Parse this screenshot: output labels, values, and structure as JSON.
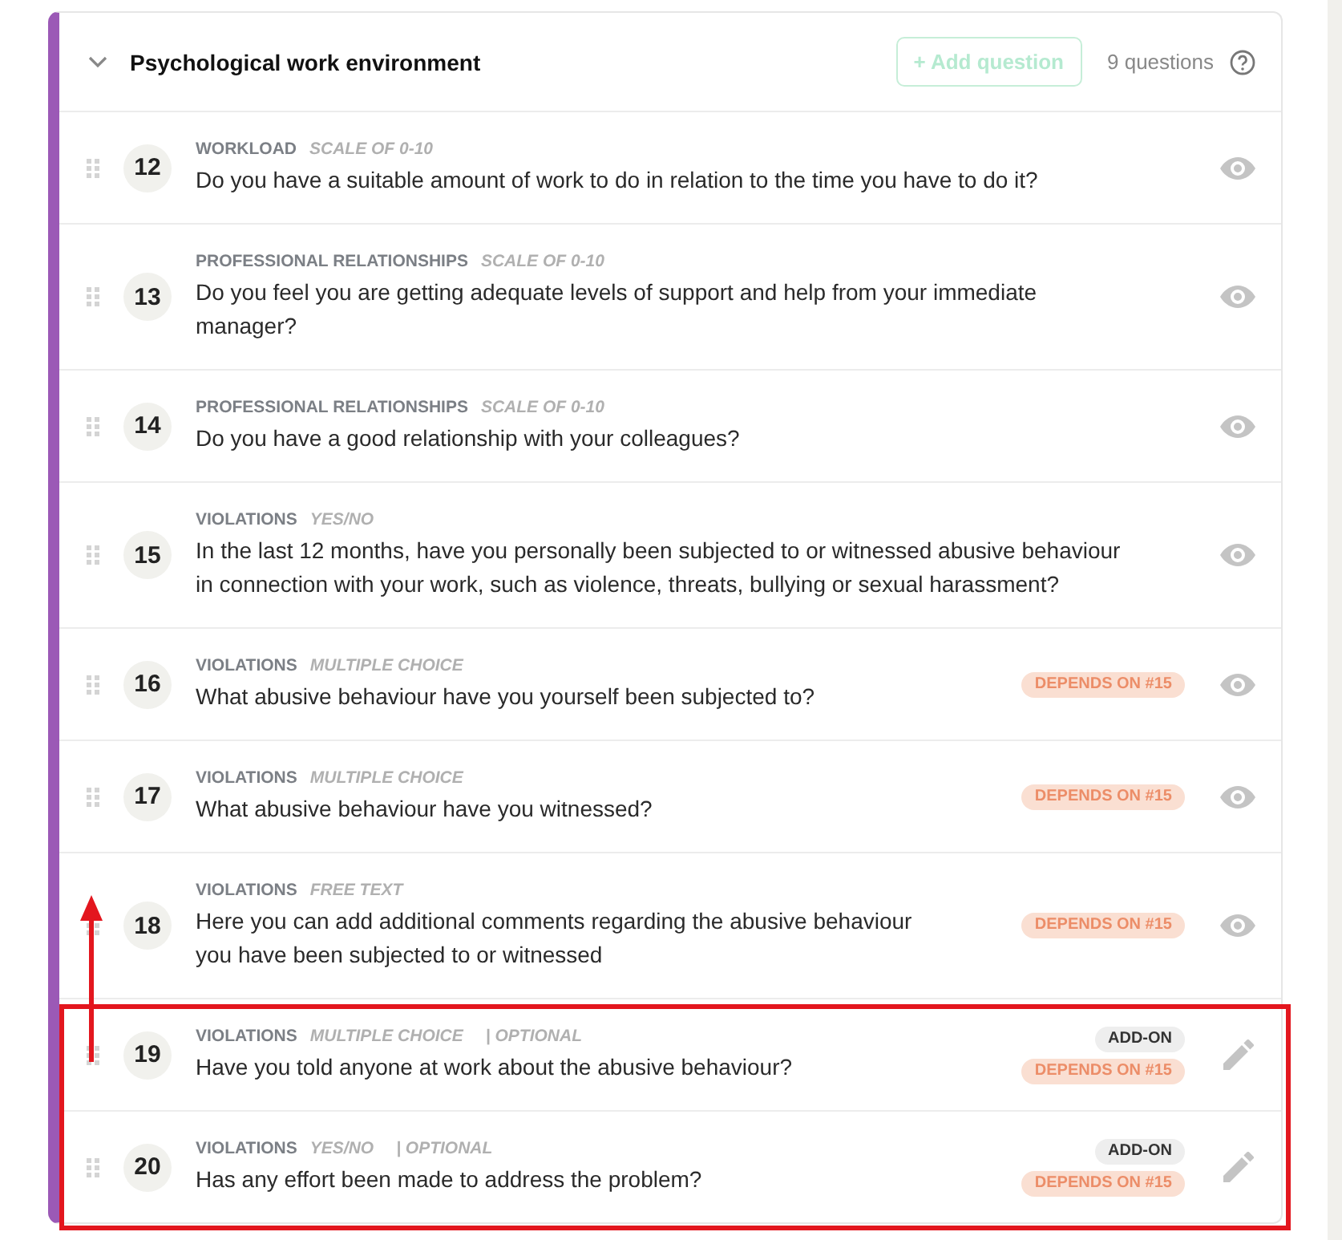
{
  "section": {
    "title": "Psychological work environment",
    "expanded": true,
    "add_button": {
      "label": "+ Add question",
      "disabled": true
    },
    "count": "9 questions"
  },
  "questions": [
    {
      "number": "12",
      "category": "WORKLOAD",
      "type": "SCALE OF 0-10",
      "text": "Do you have a suitable amount of work to do in relation to the time you have to do it?",
      "editable": false
    },
    {
      "number": "13",
      "category": "PROFESSIONAL RELATIONSHIPS",
      "type": "SCALE OF 0-10",
      "text": "Do you feel you are getting adequate levels of support and help from your immediate manager?",
      "editable": false
    },
    {
      "number": "14",
      "category": "PROFESSIONAL RELATIONSHIPS",
      "type": "SCALE OF 0-10",
      "text": "Do you have a good relationship with your colleagues?",
      "editable": false
    },
    {
      "number": "15",
      "category": "VIOLATIONS",
      "type": "YES/NO",
      "text": "In the last 12 months, have you personally been subjected to or witnessed abusive behaviour in connection with your work, such as violence, threats, bullying or sexual harassment?",
      "editable": false
    },
    {
      "number": "16",
      "category": "VIOLATIONS",
      "type": "MULTIPLE CHOICE",
      "text": "What abusive behaviour have you yourself been subjected to?",
      "badges": [
        {
          "kind": "depends",
          "label": "DEPENDS ON #15"
        }
      ],
      "editable": false
    },
    {
      "number": "17",
      "category": "VIOLATIONS",
      "type": "MULTIPLE CHOICE",
      "text": "What abusive behaviour have you witnessed?",
      "badges": [
        {
          "kind": "depends",
          "label": "DEPENDS ON #15"
        }
      ],
      "editable": false
    },
    {
      "number": "18",
      "category": "VIOLATIONS",
      "type": "FREE TEXT",
      "text": "Here you can add additional comments regarding the abusive behaviour you have been subjected to or witnessed",
      "badges": [
        {
          "kind": "depends",
          "label": "DEPENDS ON #15"
        }
      ],
      "editable": false
    },
    {
      "number": "19",
      "category": "VIOLATIONS",
      "type": "MULTIPLE CHOICE",
      "optional": "| OPTIONAL",
      "text": "Have you told anyone at work about the abusive behaviour?",
      "badges": [
        {
          "kind": "addon",
          "label": "ADD-ON"
        },
        {
          "kind": "depends",
          "label": "DEPENDS ON #15"
        }
      ],
      "editable": true
    },
    {
      "number": "20",
      "category": "VIOLATIONS",
      "type": "YES/NO",
      "optional": "| OPTIONAL",
      "text": "Has any effort been made to address the problem?",
      "badges": [
        {
          "kind": "addon",
          "label": "ADD-ON"
        },
        {
          "kind": "depends",
          "label": "DEPENDS ON #15"
        }
      ],
      "editable": true
    }
  ]
}
